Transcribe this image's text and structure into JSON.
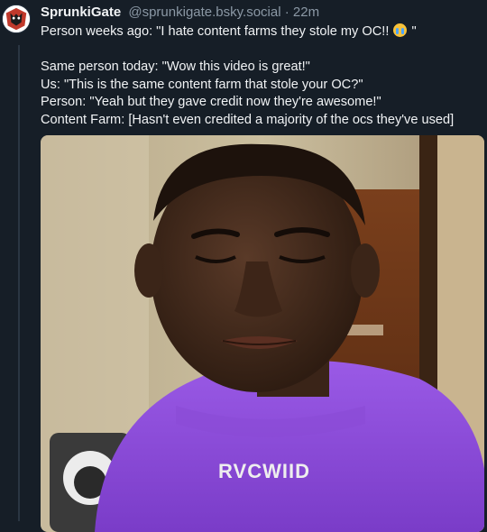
{
  "post": {
    "author_name": "SprunkiGate",
    "author_handle": "@sprunkigate.bsky.social",
    "separator": "·",
    "timestamp": "22m",
    "line1_text": "Person weeks ago: \"I hate content farms they stole my OC!! ",
    "line1_emoji": "loudly-crying-face-icon",
    "line1_end": " \"",
    "line2": "Same person today: \"Wow this video is great!\"",
    "line3": "Us: \"This is the same content farm that stole your OC?\"",
    "line4": "Person: \"Yeah but they gave credit now they're awesome!\"",
    "line5": "Content Farm: [Hasn't even credited a majority of the ocs they've used]",
    "shirt_text": "RVCWIID"
  },
  "colors": {
    "background": "#161e27",
    "text": "#f1f3f5",
    "muted": "#8b98a5",
    "shirt": "#8a4bd6"
  }
}
